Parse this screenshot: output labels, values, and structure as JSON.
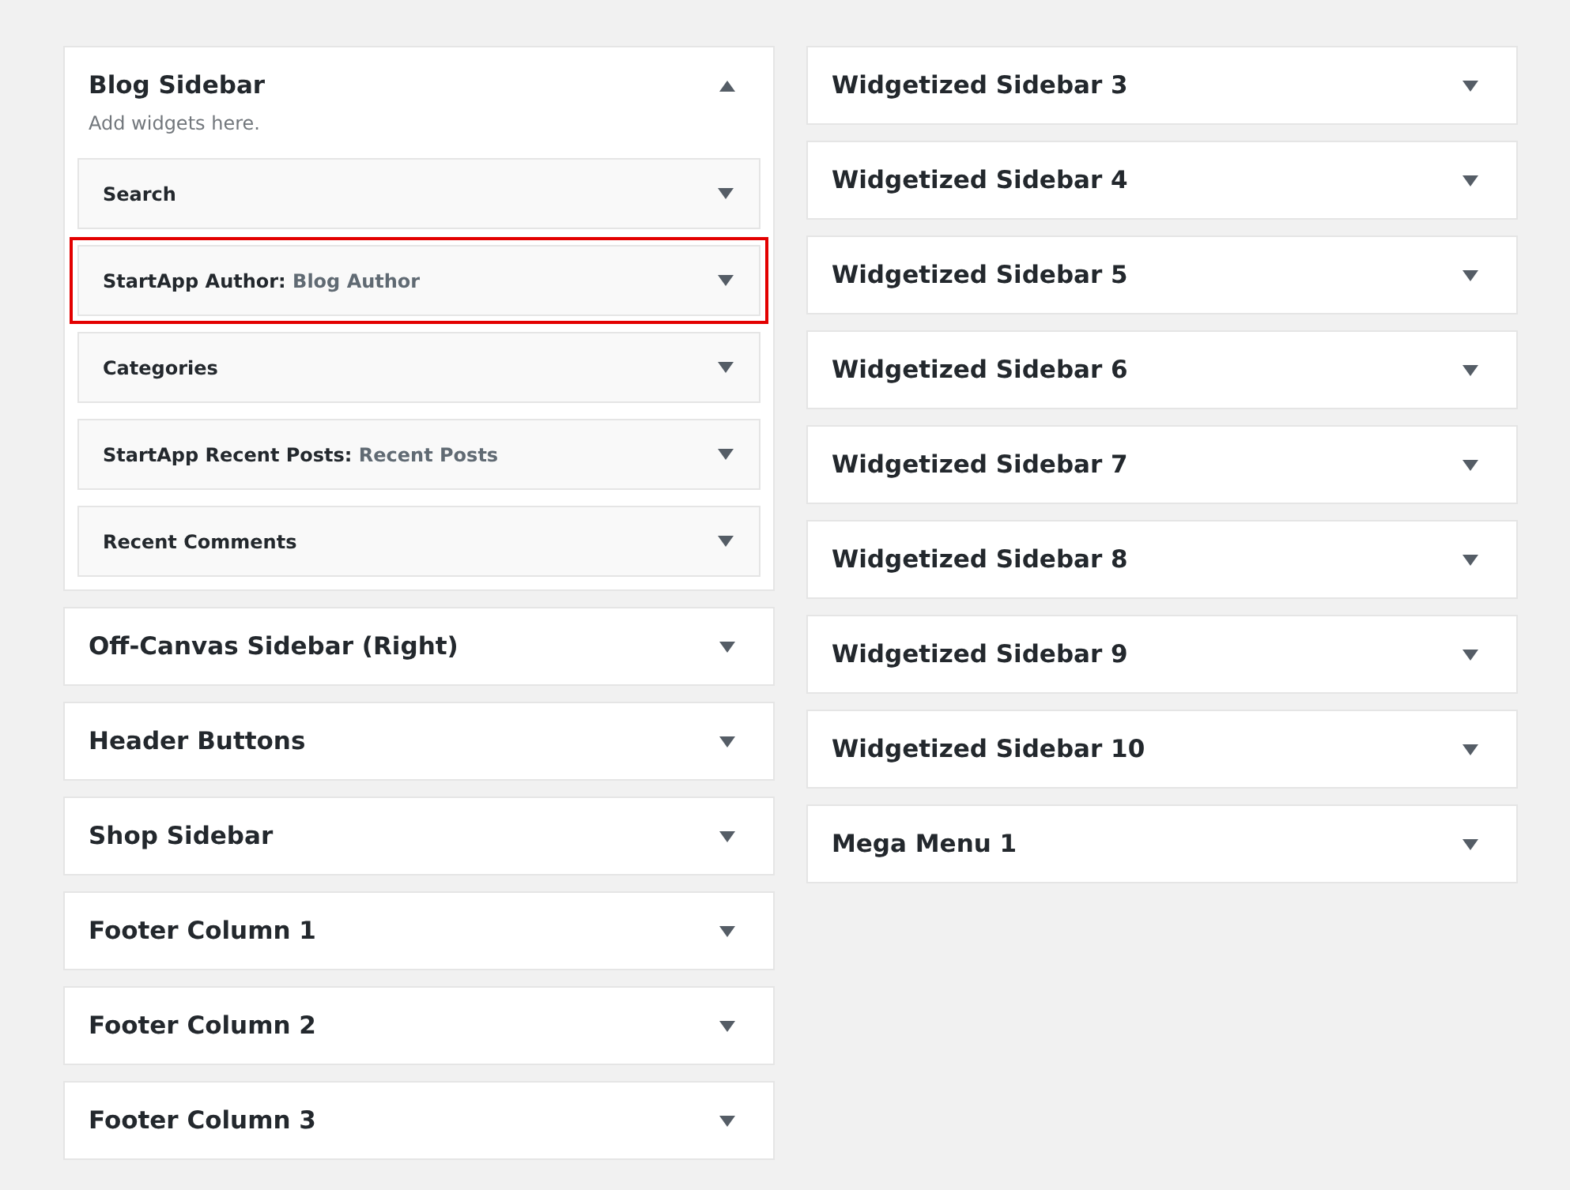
{
  "columns": [
    {
      "sidebars": [
        {
          "title": "Blog Sidebar",
          "expanded": true,
          "description": "Add widgets here.",
          "widgets": [
            {
              "label": "Search",
              "highlighted": false
            },
            {
              "label": "StartApp Author:",
              "instance": "Blog Author",
              "highlighted": true
            },
            {
              "label": "Categories",
              "highlighted": false
            },
            {
              "label": "StartApp Recent Posts:",
              "instance": "Recent Posts",
              "highlighted": false
            },
            {
              "label": "Recent Comments",
              "highlighted": false
            }
          ]
        },
        {
          "title": "Off-Canvas Sidebar (Right)",
          "expanded": false
        },
        {
          "title": "Header Buttons",
          "expanded": false
        },
        {
          "title": "Shop Sidebar",
          "expanded": false
        },
        {
          "title": "Footer Column 1",
          "expanded": false
        },
        {
          "title": "Footer Column 2",
          "expanded": false
        },
        {
          "title": "Footer Column 3",
          "expanded": false
        }
      ]
    },
    {
      "sidebars": [
        {
          "title": "Widgetized Sidebar 3",
          "expanded": false
        },
        {
          "title": "Widgetized Sidebar 4",
          "expanded": false
        },
        {
          "title": "Widgetized Sidebar 5",
          "expanded": false
        },
        {
          "title": "Widgetized Sidebar 6",
          "expanded": false
        },
        {
          "title": "Widgetized Sidebar 7",
          "expanded": false
        },
        {
          "title": "Widgetized Sidebar 8",
          "expanded": false
        },
        {
          "title": "Widgetized Sidebar 9",
          "expanded": false
        },
        {
          "title": "Widgetized Sidebar 10",
          "expanded": false
        },
        {
          "title": "Mega Menu 1",
          "expanded": false
        }
      ]
    }
  ]
}
